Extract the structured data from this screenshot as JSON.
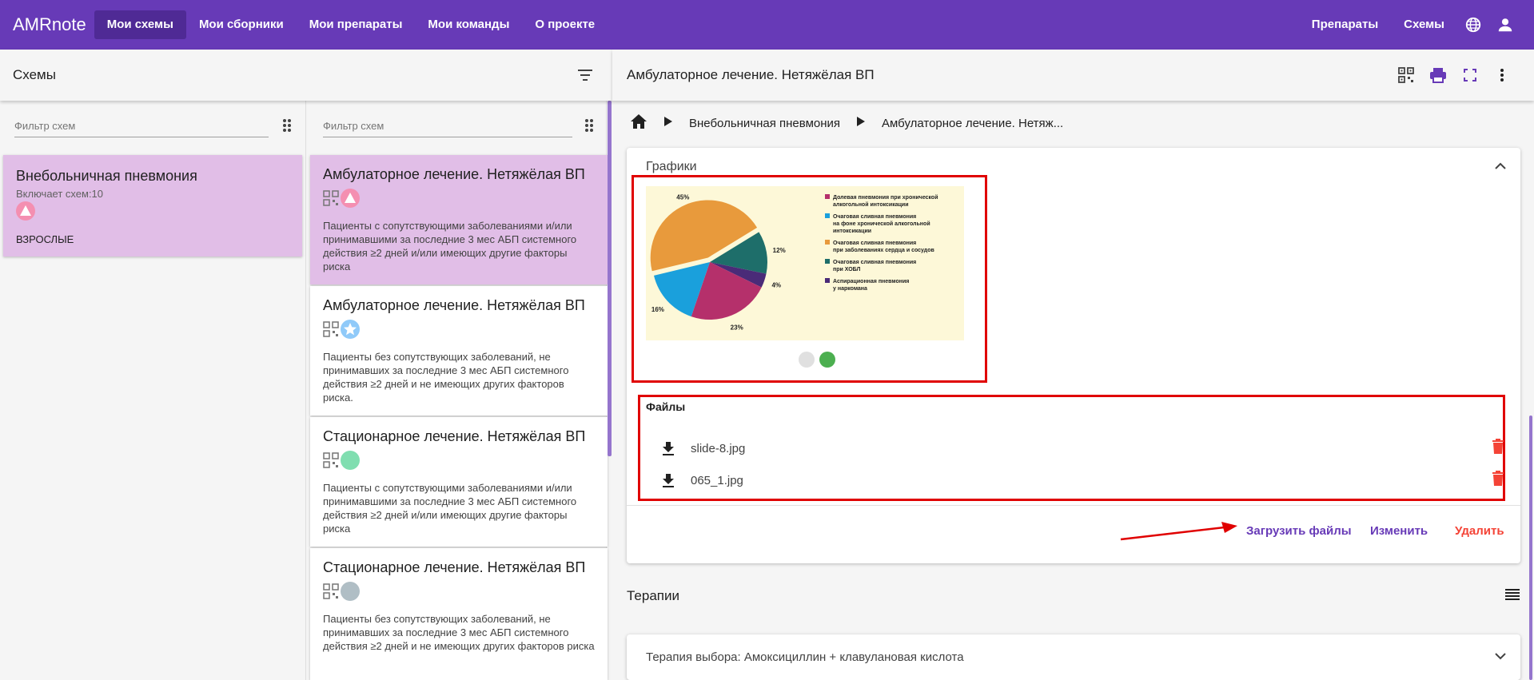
{
  "topbar": {
    "brand": "AMRnote",
    "nav": [
      "Мои схемы",
      "Мои сборники",
      "Мои препараты",
      "Мои команды",
      "О проекте"
    ],
    "right_nav": [
      "Препараты",
      "Схемы"
    ],
    "icons": [
      "globe-icon",
      "account-icon"
    ]
  },
  "left": {
    "title": "Схемы",
    "filter_placeholder": "Фильтр схем",
    "groups": [
      {
        "title": "Внебольничная пневмония",
        "subtitle": "Включает схем:10",
        "tag": "ВЗРОСЛЫЕ",
        "badge": "warning"
      }
    ]
  },
  "schemes": {
    "filter_placeholder": "Фильтр схем",
    "items": [
      {
        "title": "Амбулаторное лечение. Нетяжёлая ВП",
        "desc": "Пациенты с сопутствующими заболеваниями и/или принимавшими за последние 3 мес АБП системного действия ≥2 дней и/или имеющих другие факторы риска",
        "badge_color": "#f48fb1",
        "badge": "warning"
      },
      {
        "title": "Амбулаторное лечение. Нетяжёлая ВП",
        "desc": "Пациенты без сопутствующих заболеваний, не принимавших за последние 3 мес АБП системного действия ≥2 дней и не имеющих других факторов риска.",
        "badge_color": "#90caf9",
        "badge": "star"
      },
      {
        "title": "Стационарное лечение. Нетяжёлая ВП",
        "desc": "Пациенты с сопутствующими заболеваниями и/или принимавшими за последние 3 мес АБП системного действия ≥2 дней и/или имеющих другие факторы риска",
        "badge_color": "#80deb0",
        "badge": "circle"
      },
      {
        "title": "Стационарное лечение. Нетяжёлая ВП",
        "desc": "Пациенты без сопутствующих заболеваний, не принимавших за последние 3 мес АБП системного действия ≥2 дней и не имеющих других факторов риска",
        "badge_color": "#b0bec5",
        "badge": "circle"
      }
    ]
  },
  "detail": {
    "title": "Амбулаторное лечение. Нетяжёлая ВП",
    "breadcrumbs": [
      "Внебольничная пневмония",
      "Амбулаторное лечение. Нетяж..."
    ],
    "graphics_title": "Графики",
    "files_label": "Файлы",
    "files": [
      "slide-8.jpg",
      "065_1.jpg"
    ],
    "actions": {
      "upload": "Загрузить файлы",
      "edit": "Изменить",
      "delete": "Удалить"
    },
    "therapies_title": "Терапии",
    "therapy_item": "Терапия выбора: Амоксициллин + клавулановая кислота",
    "carousel": {
      "count": 2,
      "active": 1
    }
  },
  "chart_data": {
    "type": "pie",
    "categories": [
      "Долевая пневмония при хронической алкогольной интоксикации",
      "Очаговая сливная пневмония на фоне хронической алкогольной интоксикации",
      "Очаговая сливная пневмония при заболеваниях сердца и сосудов",
      "Очаговая сливная пневмония при ХОБЛ",
      "Аспирационная пневмония у наркомана"
    ],
    "values": [
      23,
      16,
      45,
      12,
      4
    ],
    "labels": [
      "23%",
      "16%",
      "45%",
      "12%",
      "4%"
    ],
    "colors": [
      "#b5306b",
      "#1aa0dc",
      "#e89a3c",
      "#1e6e6a",
      "#4a2b78"
    ],
    "legend": [
      "Долевая пневмония при хронической\nалкогольной интоксикации",
      "Очаговая сливная пневмония\nна фоне хронической алкогольной\nинтоксикации",
      "Очаговая сливная пневмония\nпри заболеваниях сердца и сосудов",
      "Очаговая сливная пневмония\nпри ХОБЛ",
      "Аспирационная пневмония\nу наркомана"
    ]
  }
}
